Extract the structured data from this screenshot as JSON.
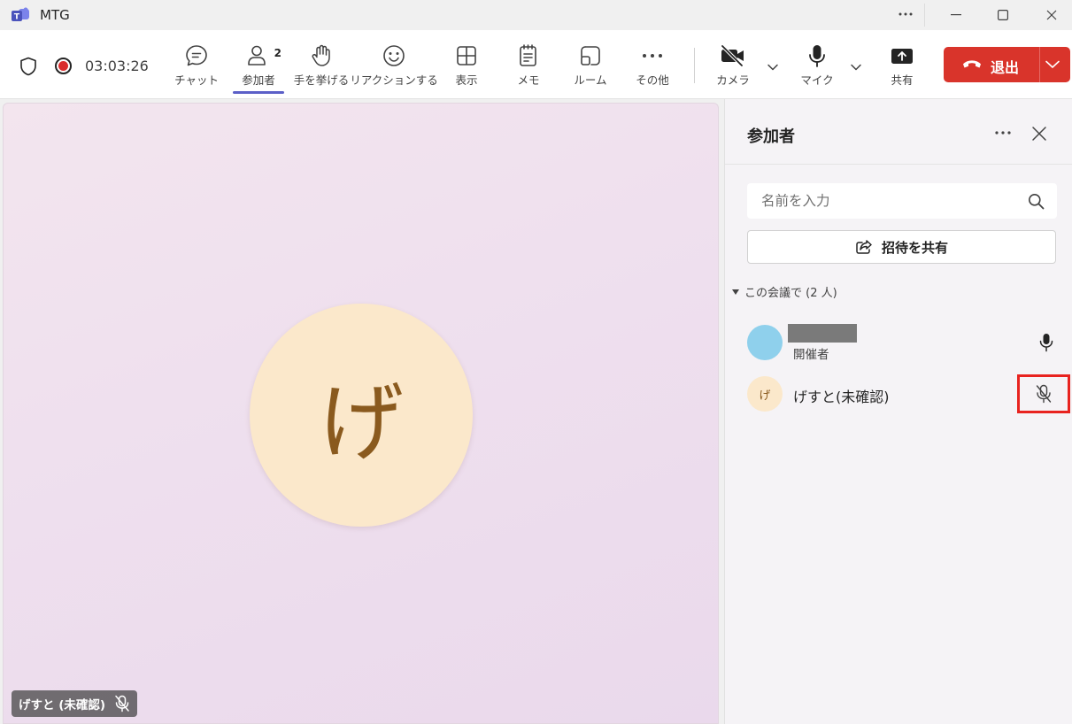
{
  "window": {
    "title": "MTG"
  },
  "toolbar": {
    "timer": "03:03:26",
    "items": [
      {
        "id": "chat",
        "label": "チャット"
      },
      {
        "id": "people",
        "label": "参加者",
        "count": "2"
      },
      {
        "id": "raise",
        "label": "手を挙げる"
      },
      {
        "id": "react",
        "label": "リアクションする"
      },
      {
        "id": "view",
        "label": "表示"
      },
      {
        "id": "notes",
        "label": "メモ"
      },
      {
        "id": "rooms",
        "label": "ルーム"
      },
      {
        "id": "more",
        "label": "その他"
      },
      {
        "id": "camera",
        "label": "カメラ"
      },
      {
        "id": "mic",
        "label": "マイク"
      },
      {
        "id": "share",
        "label": "共有"
      }
    ],
    "leave_label": "退出"
  },
  "stage": {
    "avatar_initial": "げ",
    "name_tag": "げすと (未確認)"
  },
  "panel": {
    "title": "参加者",
    "search_placeholder": "名前を入力",
    "share_invite_label": "招待を共有",
    "section_label": "この会議で (2 人)",
    "participants": [
      {
        "name": "",
        "role": "開催者",
        "initial": ""
      },
      {
        "name": "げすと(未確認)",
        "role": "",
        "initial": "げ"
      }
    ]
  },
  "colors": {
    "accent": "#5b5fc7",
    "leave": "#d9342b",
    "highlight_box": "#e8231f",
    "avatar_bg_guest": "#fbe8cb",
    "avatar_bg_host": "#8fd0ec"
  }
}
